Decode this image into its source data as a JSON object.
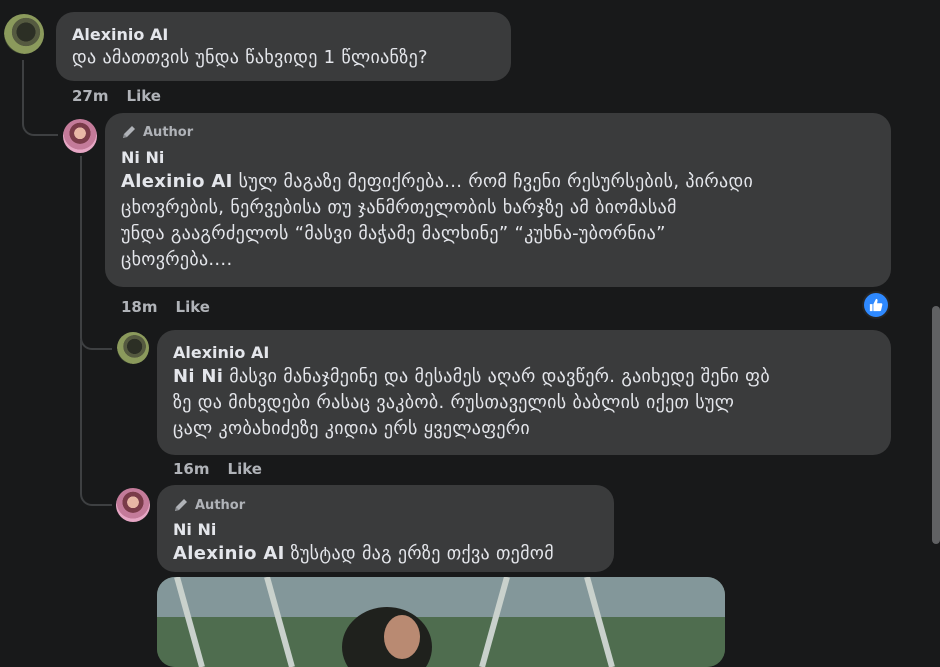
{
  "comments": [
    {
      "name": "Alexinio AI",
      "text": "და ამათთვის უნდა წახვიდე 1 წლიანზე?",
      "time": "27m",
      "like": "Like"
    },
    {
      "author_badge": "Author",
      "name": "Ni Ni",
      "mention": "Alexinio AI",
      "lines": [
        " სულ მაგაზე მეფიქრება... რომ ჩვენი რესურსების, პირადი",
        "ცხოვრების, ნერვებისა თუ ჯანმრთელობის ხარჯზე ამ ბიომასამ",
        "უნდა გააგრძელოს “მასვი მაჭამე მალხინე” “კუხნა-უბორნია”",
        "ცხოვრება...."
      ],
      "time": "18m",
      "like": "Like"
    },
    {
      "name": "Alexinio AI",
      "mention": "Ni Ni",
      "lines": [
        " მასვი მანაჯმეინე და მესამეს აღარ დავწერ. გაიხედე შენი ფბ",
        "ზე და მიხვდები რასაც ვაკბობ. რუსთაველის ბაბლის იქეთ სულ",
        "ცალ კობახიძეზე კიდია ერს ყველაფერი"
      ],
      "time": "16m",
      "like": "Like"
    },
    {
      "author_badge": "Author",
      "name": "Ni Ni",
      "mention": "Alexinio AI",
      "text": " ზუსტად მაგ ერზე თქვა თემომ"
    }
  ],
  "icons": {
    "pencil": "pencil-icon",
    "like_reaction": "thumbs-up-icon"
  },
  "colors": {
    "background": "#18191a",
    "bubble": "#3a3b3c",
    "text": "#e4e6eb",
    "secondary": "#b0b3b8",
    "like_blue": "#2e89ff"
  }
}
